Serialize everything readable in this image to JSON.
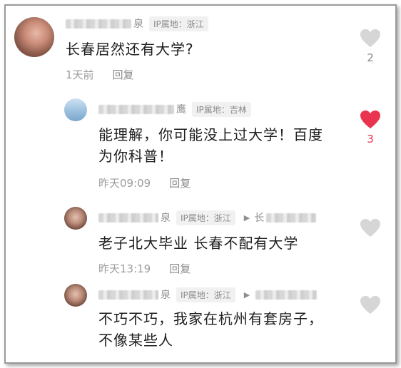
{
  "comments": [
    {
      "name_tail": "泉",
      "ip": "IP属地：浙江",
      "text": "长春居然还有大学?",
      "time": "1天前",
      "reply_label": "回复",
      "likes": "2",
      "liked": false
    },
    {
      "name_tail": "鹰",
      "ip": "IP属地：吉林",
      "text_lines": [
        "能理解，你可能没上过大学！百度",
        "为你科普！"
      ],
      "time": "昨天09:09",
      "reply_label": "回复",
      "likes": "3",
      "liked": true
    },
    {
      "name_tail": "泉",
      "ip": "IP属地：浙江",
      "reply_to": "长",
      "text": "老子北大毕业 长春不配有大学",
      "time": "昨天13:19",
      "reply_label": "回复",
      "liked": false
    },
    {
      "name_tail": "泉",
      "ip": "IP属地：浙江",
      "reply_to": "",
      "text_lines": [
        "不巧不巧，我家在杭州有套房子，",
        "不像某些人"
      ],
      "liked": false
    }
  ],
  "colors": {
    "liked": "#e8344f",
    "unliked": "#d6d6d6"
  }
}
